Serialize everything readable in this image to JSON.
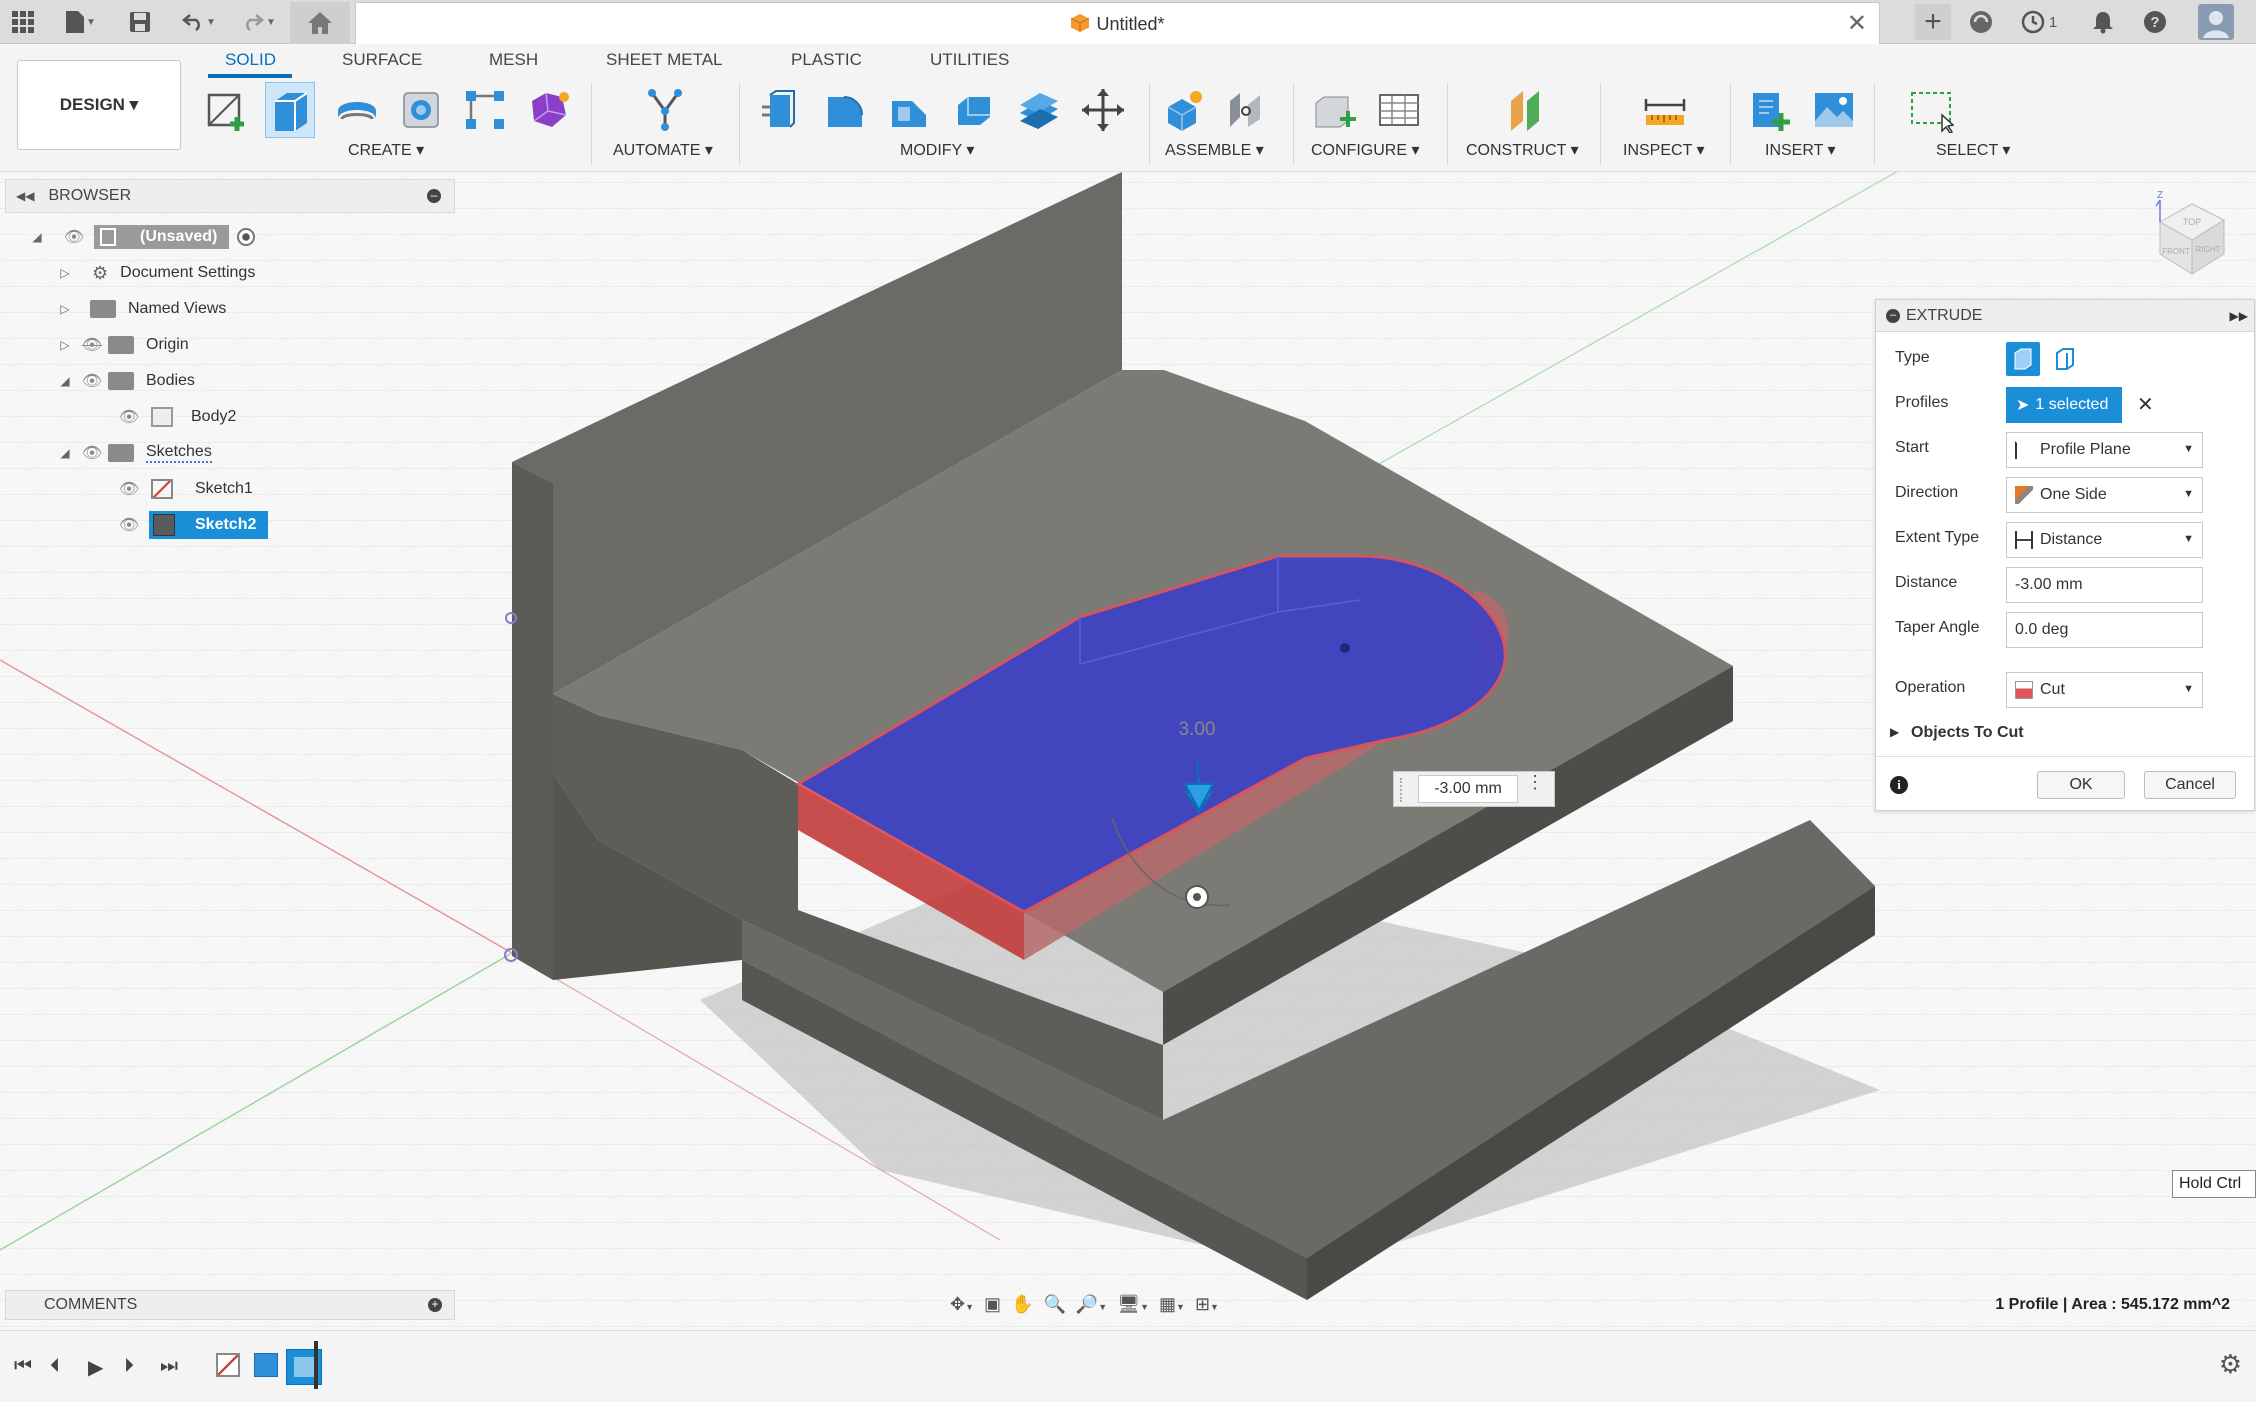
{
  "titlebar": {
    "doc_title": "Untitled*",
    "notification_count": "1"
  },
  "ribbon": {
    "design_label": "DESIGN ▾",
    "tabs": [
      "SOLID",
      "SURFACE",
      "MESH",
      "SHEET METAL",
      "PLASTIC",
      "UTILITIES"
    ],
    "groups": {
      "create": "CREATE ▾",
      "automate": "AUTOMATE ▾",
      "modify": "MODIFY ▾",
      "assemble": "ASSEMBLE ▾",
      "configure": "CONFIGURE ▾",
      "construct": "CONSTRUCT ▾",
      "inspect": "INSPECT ▾",
      "insert": "INSERT ▾",
      "select": "SELECT ▾"
    }
  },
  "browser": {
    "title": "BROWSER",
    "items": {
      "root": "(Unsaved)",
      "document_settings": "Document Settings",
      "named_views": "Named Views",
      "origin": "Origin",
      "bodies": "Bodies",
      "body2": "Body2",
      "sketches": "Sketches",
      "sketch1": "Sketch1",
      "sketch2": "Sketch2"
    }
  },
  "extrude": {
    "title": "EXTRUDE",
    "labels": {
      "type": "Type",
      "profiles": "Profiles",
      "start": "Start",
      "direction": "Direction",
      "extent_type": "Extent Type",
      "distance": "Distance",
      "taper_angle": "Taper Angle",
      "operation": "Operation",
      "objects_to_cut": "Objects To Cut"
    },
    "values": {
      "profiles": "1 selected",
      "start": "Profile Plane",
      "direction": "One Side",
      "extent_type": "Distance",
      "distance": "-3.00 mm",
      "taper_angle": "0.0 deg",
      "operation": "Cut"
    },
    "ok": "OK",
    "cancel": "Cancel"
  },
  "viewport": {
    "dim_value": "-3.00 mm",
    "dim_label": "3.00",
    "hold_ctrl": "Hold Ctrl"
  },
  "comments": "COMMENTS",
  "status": "1 Profile | Area : 545.172 mm^2",
  "colors": {
    "accent": "#0b6fb8",
    "selection": "#1a8fd8",
    "profile_fill": "#3b3fc9",
    "cut_side": "#c23b3b"
  }
}
